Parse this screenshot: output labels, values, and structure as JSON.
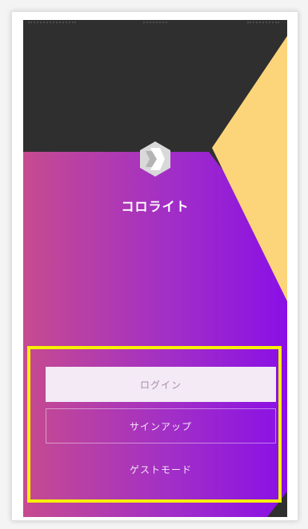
{
  "app": {
    "name": "コロライト"
  },
  "actions": {
    "login_label": "ログイン",
    "signup_label": "サインアップ",
    "guest_label": "ゲストモード"
  },
  "colors": {
    "dark_bg": "#2f2f2f",
    "yellow_shape": "#fcd57b",
    "gradient_start": "#c64b8f",
    "gradient_end": "#8a10e6",
    "highlight": "#f7f000",
    "login_button_bg": "#f3eaf6"
  },
  "icons": {
    "logo": "hexagon-logo-icon"
  }
}
